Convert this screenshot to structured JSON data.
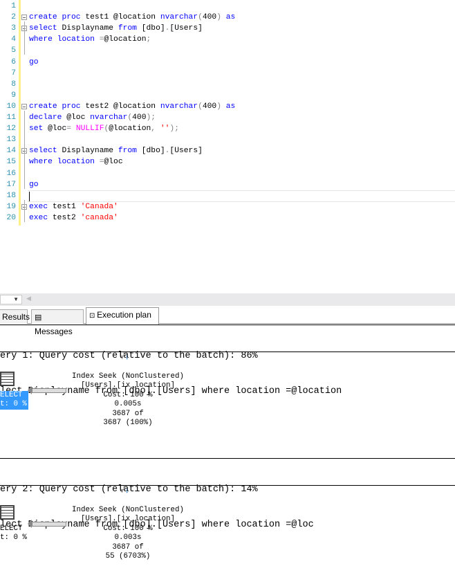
{
  "editor": {
    "lines": [
      {
        "n": "1",
        "tokens": []
      },
      {
        "n": "2",
        "tokens": [
          [
            "create proc ",
            "k"
          ],
          [
            "test1 @location ",
            "t"
          ],
          [
            "nvarchar",
            "k"
          ],
          [
            "(",
            "g"
          ],
          [
            "400",
            "t"
          ],
          [
            ") ",
            "g"
          ],
          [
            "as",
            "k"
          ]
        ]
      },
      {
        "n": "3",
        "tokens": [
          [
            "select ",
            "k"
          ],
          [
            "Displayname ",
            "t"
          ],
          [
            "from ",
            "k"
          ],
          [
            "[dbo]",
            "t"
          ],
          [
            ".",
            "g"
          ],
          [
            "[Users]",
            "t"
          ]
        ]
      },
      {
        "n": "4",
        "tokens": [
          [
            "where ",
            "k"
          ],
          [
            "location ",
            "k"
          ],
          [
            "=",
            "g"
          ],
          [
            "@location",
            "t"
          ],
          [
            ";",
            "g"
          ]
        ]
      },
      {
        "n": "5",
        "tokens": []
      },
      {
        "n": "6",
        "tokens": [
          [
            "go",
            "k"
          ]
        ]
      },
      {
        "n": "7",
        "tokens": []
      },
      {
        "n": "8",
        "tokens": []
      },
      {
        "n": "9",
        "tokens": []
      },
      {
        "n": "10",
        "tokens": [
          [
            "create proc ",
            "k"
          ],
          [
            "test2 @location ",
            "t"
          ],
          [
            "nvarchar",
            "k"
          ],
          [
            "(",
            "g"
          ],
          [
            "400",
            "t"
          ],
          [
            ") ",
            "g"
          ],
          [
            "as",
            "k"
          ]
        ]
      },
      {
        "n": "11",
        "tokens": [
          [
            "declare ",
            "k"
          ],
          [
            "@loc ",
            "t"
          ],
          [
            "nvarchar",
            "k"
          ],
          [
            "(",
            "g"
          ],
          [
            "400",
            "t"
          ],
          [
            ");",
            "g"
          ]
        ]
      },
      {
        "n": "12",
        "tokens": [
          [
            "set ",
            "k"
          ],
          [
            "@loc",
            "t"
          ],
          [
            "= ",
            "g"
          ],
          [
            "NULLIF",
            "p"
          ],
          [
            "(",
            "g"
          ],
          [
            "@location",
            "t"
          ],
          [
            ", ",
            "g"
          ],
          [
            "''",
            "s"
          ],
          [
            ");",
            "g"
          ]
        ]
      },
      {
        "n": "13",
        "tokens": []
      },
      {
        "n": "14",
        "tokens": [
          [
            "select ",
            "k"
          ],
          [
            "Displayname ",
            "t"
          ],
          [
            "from ",
            "k"
          ],
          [
            "[dbo]",
            "t"
          ],
          [
            ".",
            "g"
          ],
          [
            "[Users]",
            "t"
          ]
        ]
      },
      {
        "n": "15",
        "tokens": [
          [
            "where ",
            "k"
          ],
          [
            "location ",
            "k"
          ],
          [
            "=",
            "g"
          ],
          [
            "@loc",
            "t"
          ]
        ]
      },
      {
        "n": "16",
        "tokens": []
      },
      {
        "n": "17",
        "tokens": [
          [
            "go",
            "k"
          ]
        ]
      },
      {
        "n": "18",
        "tokens": []
      },
      {
        "n": "19",
        "tokens": [
          [
            "exec ",
            "k"
          ],
          [
            "test1 ",
            "t"
          ],
          [
            "'Canada'",
            "s"
          ]
        ]
      },
      {
        "n": "20",
        "tokens": [
          [
            "exec ",
            "k"
          ],
          [
            "test2 ",
            "t"
          ],
          [
            "'canada'",
            "s"
          ]
        ]
      }
    ]
  },
  "tabs": [
    {
      "label": "Results",
      "icon": "results-grid-icon"
    },
    {
      "label": "Messages",
      "icon": "messages-icon"
    },
    {
      "label": "Execution plan",
      "icon": "execution-plan-icon",
      "active": true
    }
  ],
  "plans": [
    {
      "header": "ery 1: Query cost (relative to the batch): 86%",
      "query": "lect Displayname from [dbo].[Users] where location =@location",
      "select_label": "ELECT",
      "select_cost": "t: 0 %",
      "selected": true,
      "seek": [
        "Index Seek (NonClustered)",
        "[Users].[ix_location]",
        "Cost: 100 %",
        "0.005s",
        "3687 of",
        "3687 (100%)"
      ]
    },
    {
      "header": "ery 2: Query cost (relative to the batch): 14%",
      "query": "lect Displayname from [dbo].[Users] where location =@loc",
      "select_label": "ELECT",
      "select_cost": "t: 0 %",
      "selected": false,
      "seek": [
        "Index Seek (NonClustered)",
        "[Users].[ix_location]",
        "Cost: 100 %",
        "0.003s",
        "3687 of",
        "55 (6703%)"
      ]
    }
  ],
  "colors": {
    "keyword": "#0000ff",
    "function": "#ff00ff",
    "string": "#ff0000",
    "selection": "#3399ff"
  }
}
